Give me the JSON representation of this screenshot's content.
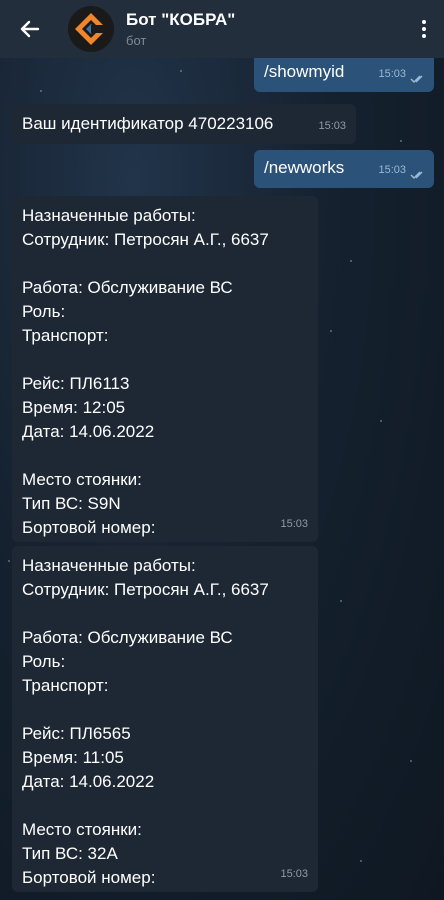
{
  "header": {
    "title": "Бот \"КОБРА\"",
    "subtitle": "бот"
  },
  "messages": {
    "m1": {
      "text": "/showmyid",
      "time": "15:03"
    },
    "m2": {
      "text": "Ваш идентификатор 470223106",
      "time": "15:03"
    },
    "m3": {
      "text": "/newworks",
      "time": "15:03"
    },
    "m4": {
      "lines": [
        "Назначенные работы:",
        "Сотрудник: Петросян А.Г., 6637",
        "",
        "Работа: Обслуживание ВС",
        "Роль:",
        "Транспорт:",
        "",
        "Рейс: ПЛ6113",
        "Время: 12:05",
        "Дата: 14.06.2022",
        "",
        "Место стоянки:",
        "Тип ВС: S9N",
        "Бортовой номер:"
      ],
      "time": "15:03"
    },
    "m5": {
      "lines": [
        "Назначенные работы:",
        "Сотрудник: Петросян А.Г., 6637",
        "",
        "Работа: Обслуживание ВС",
        "Роль:",
        "Транспорт:",
        "",
        "Рейс: ПЛ6565",
        "Время: 11:05",
        "Дата: 14.06.2022",
        "",
        "Место стоянки:",
        "Тип ВС: 32А",
        "Бортовой номер:"
      ],
      "time": "15:03"
    }
  }
}
